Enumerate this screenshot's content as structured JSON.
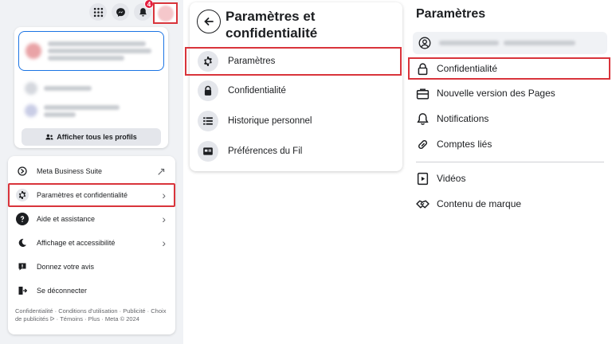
{
  "panel1": {
    "notification_badge": "4",
    "show_all_profiles_label": "Afficher tous les profils",
    "menu": [
      {
        "label": "Meta Business Suite",
        "icon": "business-suite-icon",
        "trailing": "↗"
      },
      {
        "label": "Paramètres et confidentialité",
        "icon": "gear-icon",
        "trailing": "›"
      },
      {
        "label": "Aide et assistance",
        "icon": "help-icon",
        "trailing": "›"
      },
      {
        "label": "Affichage et accessibilité",
        "icon": "moon-icon",
        "trailing": "›"
      },
      {
        "label": "Donnez votre avis",
        "icon": "feedback-icon",
        "trailing": ""
      },
      {
        "label": "Se déconnecter",
        "icon": "logout-icon",
        "trailing": ""
      }
    ],
    "footer": "Confidentialité · Conditions d'utilisation · Publicité · Choix de publicités ᐅ · Témoins · Plus · Meta © 2024"
  },
  "panel2": {
    "title": "Paramètres et confidentialité",
    "items": [
      {
        "label": "Paramètres",
        "icon": "gear-icon"
      },
      {
        "label": "Confidentialité",
        "icon": "lock-icon"
      },
      {
        "label": "Historique personnel",
        "icon": "list-icon"
      },
      {
        "label": "Préférences du Fil",
        "icon": "feed-icon"
      }
    ]
  },
  "panel3": {
    "title": "Paramètres",
    "items": [
      {
        "label": "Confidentialité",
        "icon": "lock-icon"
      },
      {
        "label": "Nouvelle version des Pages",
        "icon": "briefcase-icon"
      },
      {
        "label": "Notifications",
        "icon": "bell-icon"
      },
      {
        "label": "Comptes liés",
        "icon": "link-icon"
      },
      {
        "label": "Vidéos",
        "icon": "video-icon"
      },
      {
        "label": "Contenu de marque",
        "icon": "handshake-icon"
      }
    ]
  },
  "colors": {
    "highlight": "#d9343b",
    "facebook_blue": "#1b74e4",
    "badge_red": "#e41e3f"
  }
}
